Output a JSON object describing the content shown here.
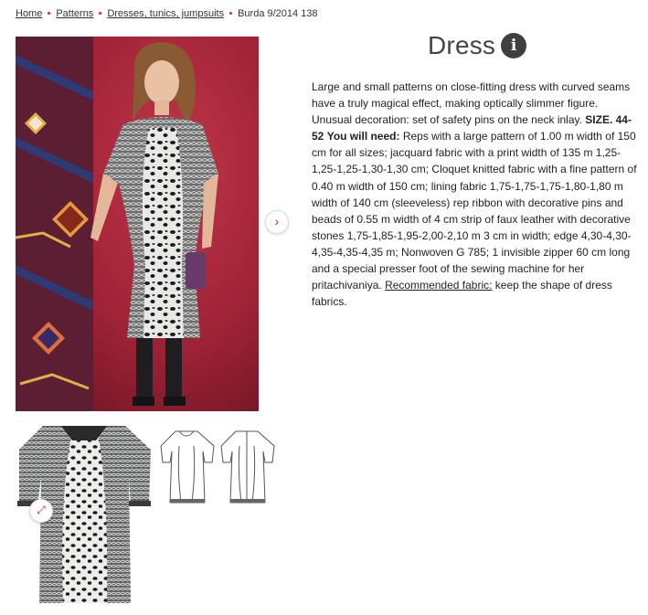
{
  "breadcrumb": {
    "home": "Home",
    "patterns": "Patterns",
    "category": "Dresses, tunics, jumpsuits",
    "current": "Burda 9/2014 138"
  },
  "product": {
    "title": "Dress",
    "info_glyph": "i",
    "description": {
      "intro": "Large and small patterns on close-fitting dress with curved seams have a truly magical effect, making optically slimmer figure. Unusual decoration: set of safety pins on the neck inlay.",
      "size_label": "SIZE. 44-52",
      "need_label": "You will need:",
      "materials": "Reps with a large pattern of 1.00 m width of 150 cm for all sizes; jacquard fabric with a print width of 135 m 1,25-1,25-1,25-1,30-1,30 cm; Cloquet knitted fabric with a fine pattern of 0.40 m width of 150 cm; lining fabric 1,75-1,75-1,75-1,80-1,80 m width of 140 cm (sleeveless) rep ribbon with decorative pins and beads of 0.55 m width of 4 cm strip of faux leather with decorative stones 1,75-1,85-1,95-2,00-2,10 m 3 cm in width; edge 4,30-4,30-4,35-4,35-4,35 m; Nonwoven G 785; 1 invisible zipper 60 cm long and a special presser foot of the sewing machine for her pritachivaniya.",
      "recommended_label": "Recommended fabric:",
      "recommended_text": "keep the shape of dress fabrics."
    }
  },
  "gallery": {
    "next_glyph": "›",
    "expand_glyph": "⤢"
  },
  "colors": {
    "accent": "#d6263f",
    "backdrop": "#a5283a",
    "rug": "#5a1b2a"
  }
}
